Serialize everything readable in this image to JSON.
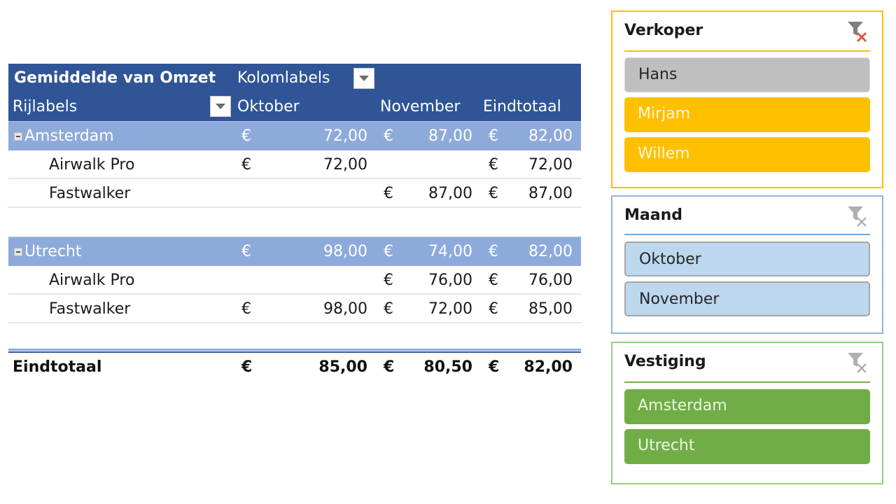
{
  "pivot": {
    "value_field": "Gemiddelde van Omzet",
    "column_labels": "Kolomlabels",
    "row_labels": "Rijlabels",
    "columns": [
      "Oktober",
      "November",
      "Eindtotaal"
    ],
    "currency": "€",
    "groups": [
      {
        "name": "Amsterdam",
        "values": [
          "72,00",
          "87,00",
          "82,00"
        ],
        "items": [
          {
            "name": "Airwalk Pro",
            "values": [
              "72,00",
              "",
              "72,00"
            ]
          },
          {
            "name": "Fastwalker",
            "values": [
              "",
              "87,00",
              "87,00"
            ]
          }
        ]
      },
      {
        "name": "Utrecht",
        "values": [
          "98,00",
          "74,00",
          "82,00"
        ],
        "items": [
          {
            "name": "Airwalk Pro",
            "values": [
              "",
              "76,00",
              "76,00"
            ]
          },
          {
            "name": "Fastwalker",
            "values": [
              "98,00",
              "72,00",
              "85,00"
            ]
          }
        ]
      }
    ],
    "grand_total": {
      "label": "Eindtotaal",
      "values": [
        "85,00",
        "80,50",
        "82,00"
      ]
    }
  },
  "slicers": [
    {
      "title": "Verkoper",
      "accent": "#ffc000",
      "clear_filter_active": true,
      "items": [
        {
          "label": "Hans",
          "selected": false
        },
        {
          "label": "Mirjam",
          "selected": true
        },
        {
          "label": "Willem",
          "selected": true
        }
      ]
    },
    {
      "title": "Maand",
      "accent": "#6fa8dc",
      "clear_filter_active": false,
      "items": [
        {
          "label": "Oktober",
          "selected": true
        },
        {
          "label": "November",
          "selected": true
        }
      ]
    },
    {
      "title": "Vestiging",
      "accent": "#70ad47",
      "clear_filter_active": false,
      "items": [
        {
          "label": "Amsterdam",
          "selected": true
        },
        {
          "label": "Utrecht",
          "selected": true
        }
      ]
    }
  ],
  "colors": {
    "header_bg": "#2f5597",
    "group_bg": "#8eaadb"
  }
}
